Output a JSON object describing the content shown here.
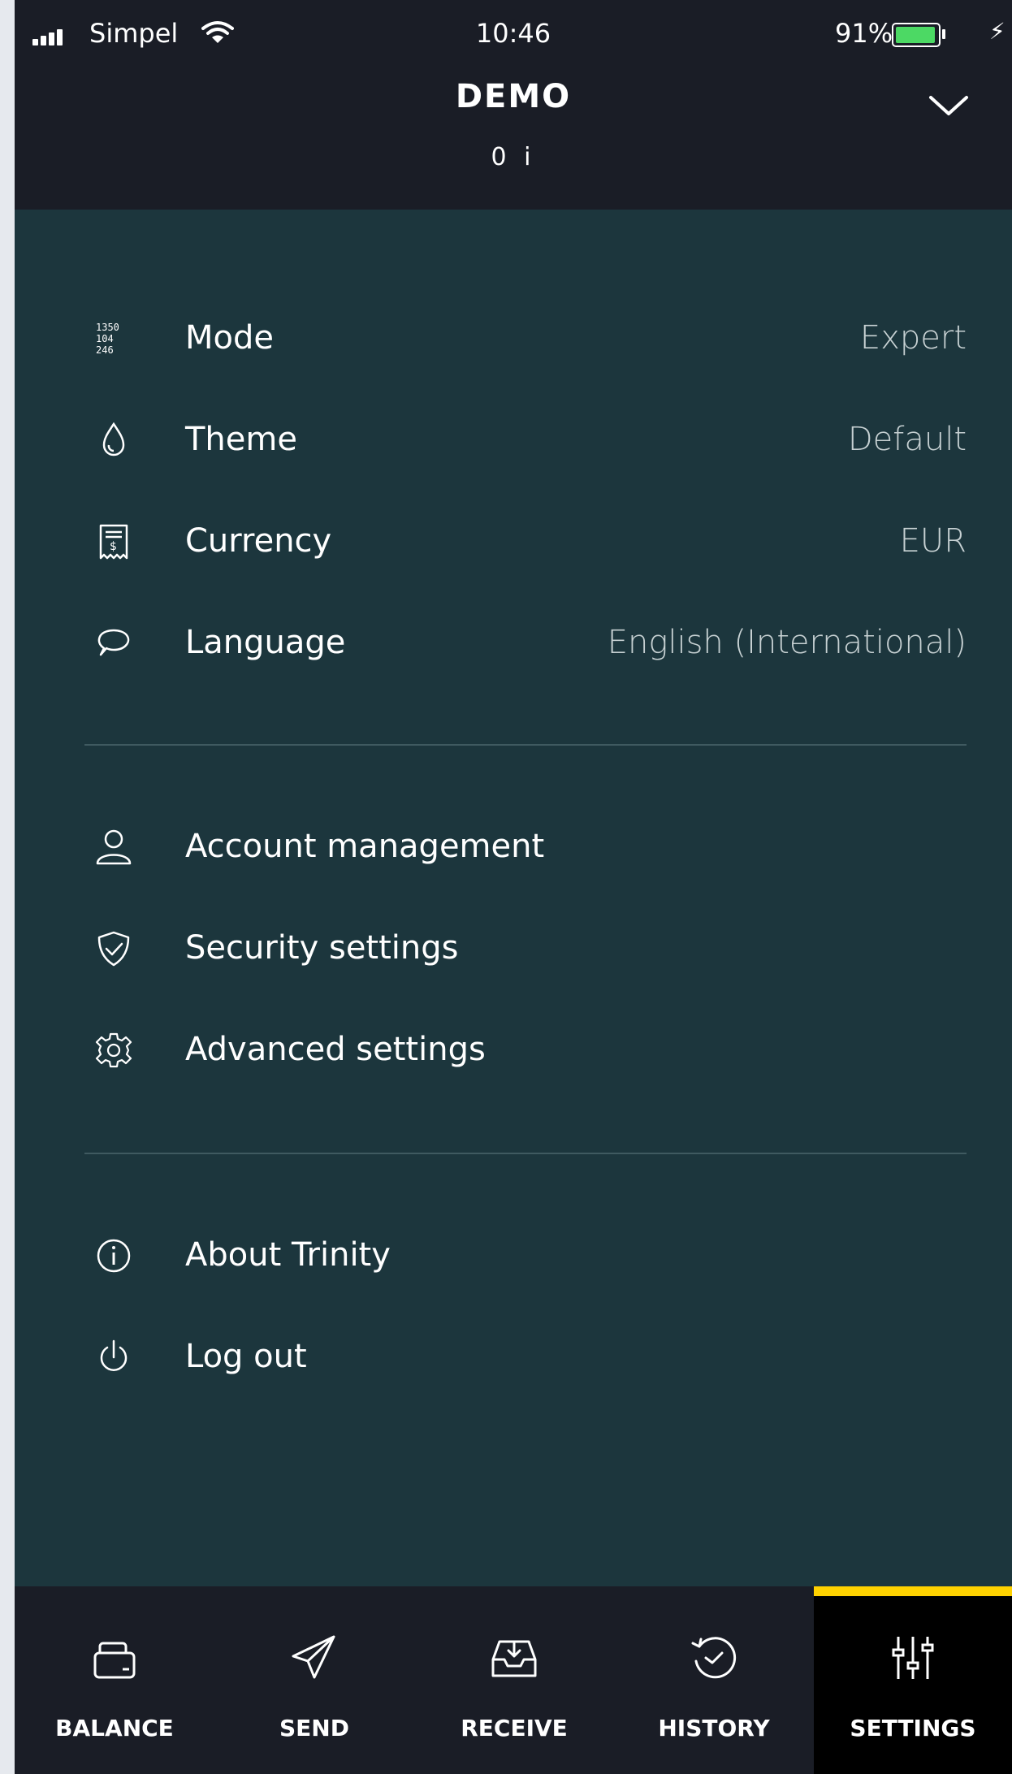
{
  "status_bar": {
    "carrier": "Simpel",
    "time": "10:46",
    "battery": "91%",
    "charge_symbol": "⚡"
  },
  "header": {
    "account_name": "DEMO",
    "balance": "0 i"
  },
  "settings": {
    "primary": [
      {
        "label": "Mode",
        "value": "Expert",
        "icon": "mode-icon"
      },
      {
        "label": "Theme",
        "value": "Default",
        "icon": "droplet-icon"
      },
      {
        "label": "Currency",
        "value": "EUR",
        "icon": "receipt-icon"
      },
      {
        "label": "Language",
        "value": "English (International)",
        "icon": "speech-bubble-icon"
      }
    ],
    "secondary": [
      {
        "label": "Account management",
        "icon": "user-icon"
      },
      {
        "label": "Security settings",
        "icon": "shield-icon"
      },
      {
        "label": "Advanced settings",
        "icon": "gear-icon"
      }
    ],
    "tertiary": [
      {
        "label": "About Trinity",
        "icon": "info-icon"
      },
      {
        "label": "Log out",
        "icon": "power-icon"
      }
    ]
  },
  "nav": {
    "tabs": [
      {
        "label": "BALANCE",
        "icon": "wallet-icon"
      },
      {
        "label": "SEND",
        "icon": "paper-plane-icon"
      },
      {
        "label": "RECEIVE",
        "icon": "inbox-icon"
      },
      {
        "label": "HISTORY",
        "icon": "history-icon"
      },
      {
        "label": "SETTINGS",
        "icon": "sliders-icon"
      }
    ],
    "active": "SETTINGS",
    "accent_color": "#ffd200"
  },
  "colors": {
    "background": "#1c363d",
    "header": "#1a1d26",
    "battery": "#4cd964"
  }
}
